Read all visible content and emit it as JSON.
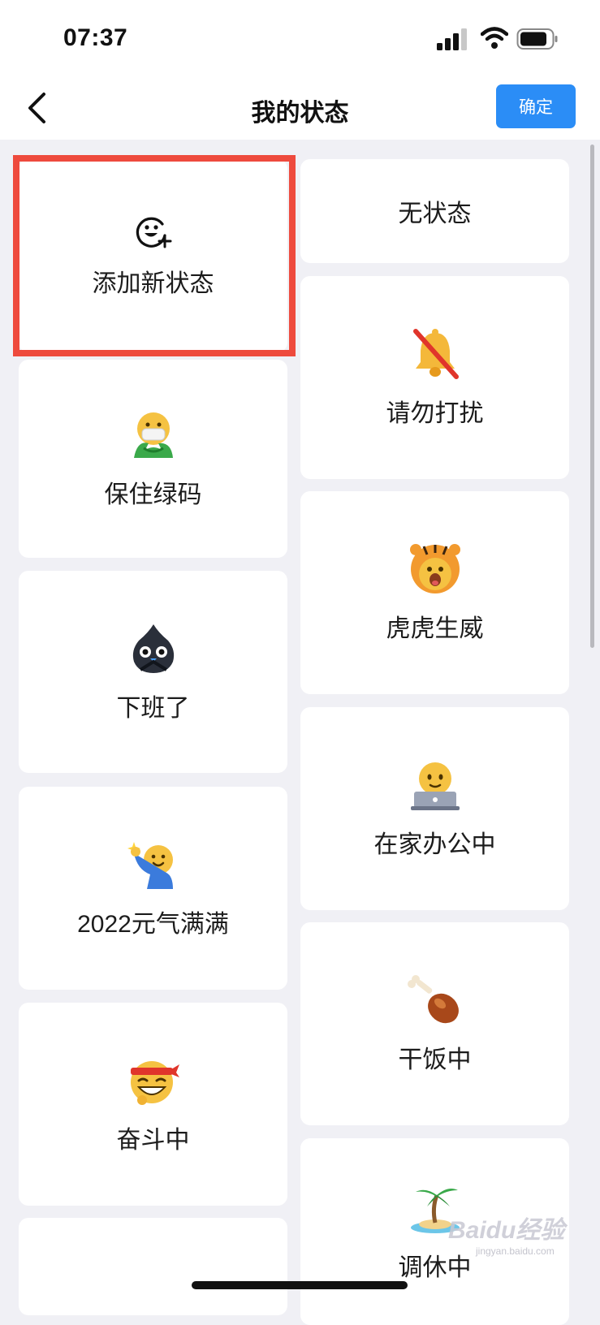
{
  "status_bar": {
    "time": "07:37"
  },
  "header": {
    "title": "我的状态",
    "confirm_label": "确定"
  },
  "left_column": [
    {
      "label": "添加新状态",
      "icon": "add-emoji-icon"
    },
    {
      "label": "保住绿码",
      "icon": "mask-face-green-code-icon"
    },
    {
      "label": "下班了",
      "icon": "black-blob-bow-icon"
    },
    {
      "label": "2022元气满满",
      "icon": "energetic-cheer-icon"
    },
    {
      "label": "奋斗中",
      "icon": "headband-grin-icon"
    },
    {
      "label": "",
      "icon": ""
    }
  ],
  "right_column": [
    {
      "label": "无状态",
      "icon": ""
    },
    {
      "label": "请勿打扰",
      "icon": "muted-bell-icon"
    },
    {
      "label": "虎虎生威",
      "icon": "tiger-costume-icon"
    },
    {
      "label": "在家办公中",
      "icon": "laptop-face-icon"
    },
    {
      "label": "干饭中",
      "icon": "drumstick-icon"
    },
    {
      "label": "调休中",
      "icon": "palm-island-icon"
    }
  ],
  "watermark": {
    "brand": "Baidu经验",
    "url": "jingyan.baidu.com"
  },
  "colors": {
    "accent": "#2b8df6",
    "highlight": "#ee4a3d",
    "background": "#f0f0f5"
  }
}
